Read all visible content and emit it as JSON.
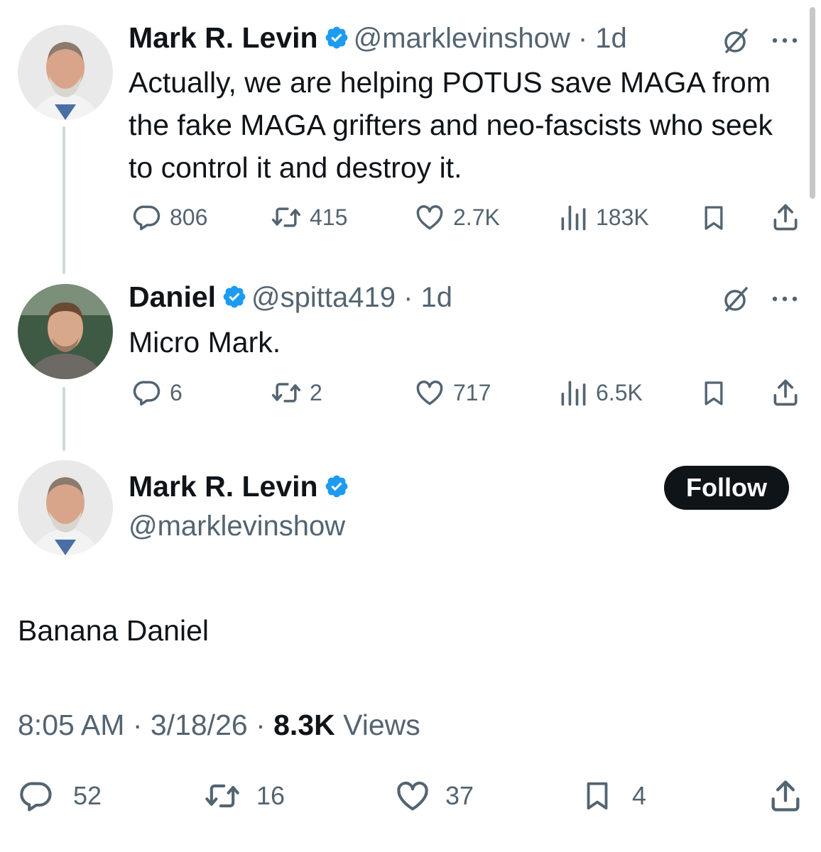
{
  "tweets": [
    {
      "name": "Mark R. Levin",
      "handle": "@marklevinshow",
      "time": "1d",
      "text": "Actually, we are helping POTUS save MAGA from the fake MAGA grifters and neo-fascists who seek to control it and destroy it.",
      "stats": {
        "replies": "806",
        "reposts": "415",
        "likes": "2.7K",
        "views": "183K"
      }
    },
    {
      "name": "Daniel",
      "handle": "@spitta419",
      "time": "1d",
      "text": "Micro Mark.",
      "stats": {
        "replies": "6",
        "reposts": "2",
        "likes": "717",
        "views": "6.5K"
      }
    }
  ],
  "main_tweet": {
    "name": "Mark R. Levin",
    "handle": "@marklevinshow",
    "follow_label": "Follow",
    "text": "Banana Daniel",
    "time": "8:05 AM",
    "date": "3/18/26",
    "views_count": "8.3K",
    "views_label": "Views",
    "stats": {
      "replies": "52",
      "reposts": "16",
      "likes": "37",
      "bookmarks": "4"
    }
  },
  "icons": {
    "verified": "verified-badge-icon",
    "grok": "grok-icon",
    "more": "more-icon",
    "reply": "reply-icon",
    "repost": "repost-icon",
    "like": "like-icon",
    "views": "views-icon",
    "bookmark": "bookmark-icon",
    "share": "share-icon"
  },
  "colors": {
    "verified": "#1d9bf0",
    "text": "#0f1419",
    "secondary": "#536471",
    "thread_line": "#cfd9de"
  }
}
